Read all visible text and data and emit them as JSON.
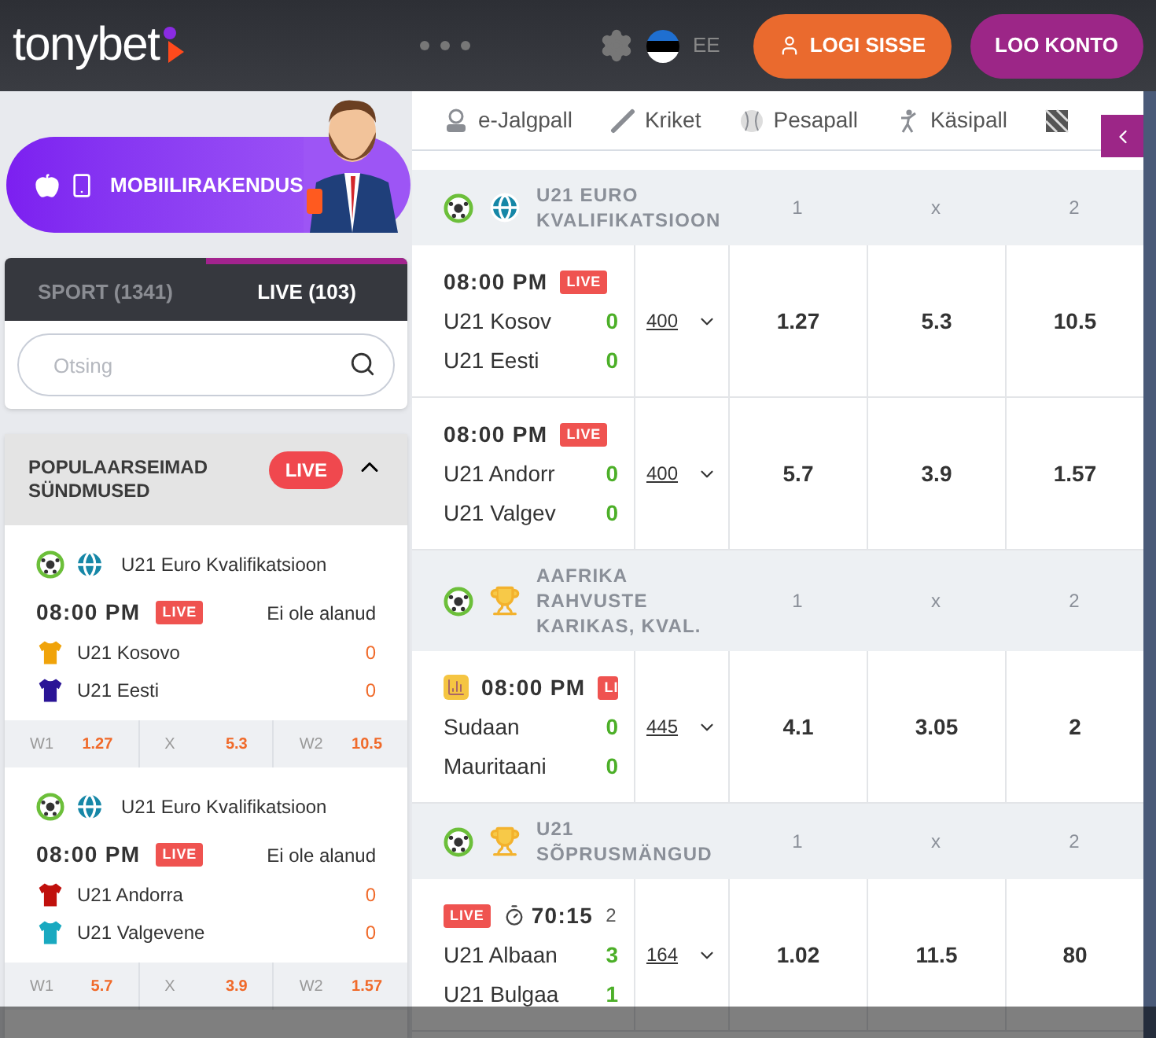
{
  "header": {
    "logo": "tonybet",
    "language": "EE",
    "login_button": "LOGI SISSE",
    "register_button": "LOO KONTO"
  },
  "promo": {
    "label": "MOBIILIRAKENDUS"
  },
  "sidebar_tabs": [
    {
      "label": "SPORT (1341)",
      "selected": false
    },
    {
      "label": "LIVE (103)",
      "selected": true
    }
  ],
  "search": {
    "placeholder": "Otsing"
  },
  "popular": {
    "title": "POPULAARSEIMAD SÜNDMUSED",
    "badge": "LIVE",
    "expanded": true,
    "events": [
      {
        "league": "U21 Euro Kvalifikatsioon",
        "time": "08:00 PM",
        "live": "LIVE",
        "status": "Ei ole alanud",
        "teams": [
          {
            "name": "U21 Kosovo",
            "score": "0",
            "color": "#f0a30a"
          },
          {
            "name": "U21 Eesti",
            "score": "0",
            "color": "#2a1496"
          }
        ],
        "odds": [
          {
            "label": "W1",
            "value": "1.27"
          },
          {
            "label": "X",
            "value": "5.3"
          },
          {
            "label": "W2",
            "value": "10.5"
          }
        ]
      },
      {
        "league": "U21 Euro Kvalifikatsioon",
        "time": "08:00 PM",
        "live": "LIVE",
        "status": "Ei ole alanud",
        "teams": [
          {
            "name": "U21 Andorra",
            "score": "0",
            "color": "#c0100c"
          },
          {
            "name": "U21 Valgevene",
            "score": "0",
            "color": "#19a9c0"
          }
        ],
        "odds": [
          {
            "label": "W1",
            "value": "5.7"
          },
          {
            "label": "X",
            "value": "3.9"
          },
          {
            "label": "W2",
            "value": "1.57"
          }
        ]
      }
    ]
  },
  "sport_tabs": [
    {
      "kind": "esoccer",
      "label": "e-Jalgpall"
    },
    {
      "kind": "cricket",
      "label": "Kriket"
    },
    {
      "kind": "baseball",
      "label": "Pesapall"
    },
    {
      "kind": "handball",
      "label": "Käsipall"
    },
    {
      "kind": "cut"
    }
  ],
  "leagues": [
    {
      "kind": "world",
      "name": "U21 EURO KVALIFIKATSIOON",
      "columns": [
        "1",
        "x",
        "2"
      ],
      "matches": [
        {
          "head": [
            {
              "kind": "time",
              "text": "08:00 PM"
            },
            {
              "kind": "live",
              "text": "LIVE"
            }
          ],
          "teams": [
            {
              "name": "U21 Kosov",
              "score": "0"
            },
            {
              "name": "U21 Eesti",
              "score": "0"
            }
          ],
          "markets": "400",
          "odds": [
            "1.27",
            "5.3",
            "10.5"
          ]
        },
        {
          "head": [
            {
              "kind": "time",
              "text": "08:00 PM"
            },
            {
              "kind": "live",
              "text": "LIVE"
            }
          ],
          "teams": [
            {
              "name": "U21 Andorr",
              "score": "0"
            },
            {
              "name": "U21 Valgev",
              "score": "0"
            }
          ],
          "markets": "400",
          "odds": [
            "5.7",
            "3.9",
            "1.57"
          ]
        }
      ]
    },
    {
      "kind": "cup",
      "name": "AAFRIKA RAHVUSTE KARIKAS, KVAL.",
      "columns": [
        "1",
        "x",
        "2"
      ],
      "matches": [
        {
          "head": [
            {
              "kind": "stats"
            },
            {
              "kind": "time",
              "text": "08:00 PM"
            },
            {
              "kind": "live",
              "text": "LI"
            }
          ],
          "teams": [
            {
              "name": "Sudaan",
              "score": "0"
            },
            {
              "name": "Mauritaani",
              "score": "0"
            }
          ],
          "markets": "445",
          "odds": [
            "4.1",
            "3.05",
            "2"
          ]
        }
      ]
    },
    {
      "kind": "cup",
      "name": "U21 SÕPRUSMÄNGUD",
      "columns": [
        "1",
        "x",
        "2"
      ],
      "matches": [
        {
          "head": [
            {
              "kind": "live",
              "text": "LIVE"
            },
            {
              "kind": "timer",
              "text": "70:15"
            },
            {
              "kind": "period",
              "text": "2"
            }
          ],
          "teams": [
            {
              "name": "U21 Albaan",
              "score": "3"
            },
            {
              "name": "U21 Bulgaa",
              "score": "1"
            }
          ],
          "markets": "164",
          "odds": [
            "1.02",
            "11.5",
            "80"
          ]
        }
      ]
    }
  ]
}
